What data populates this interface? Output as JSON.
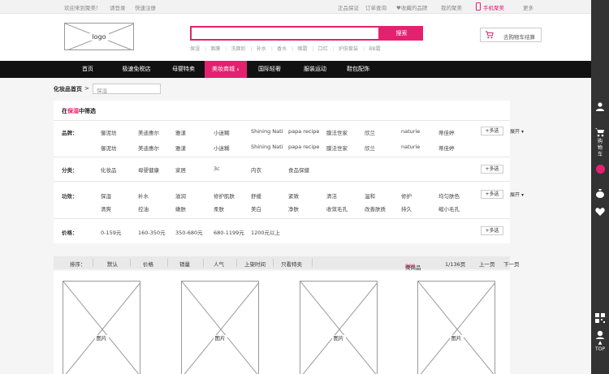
{
  "topbar": {
    "welcome": "欢迎来到聚美！",
    "login": "请登录",
    "register": "快速注册",
    "guarantee": "正品保证",
    "order_query": "订单查询",
    "favorites": "♥收藏的品牌",
    "my_jumei": "我的聚美",
    "mobile": "手机聚美",
    "more": "更多"
  },
  "header": {
    "logo": "logo",
    "search_button": "搜索",
    "hot_words": [
      "保湿",
      "面膜",
      "洗面奶",
      "补水",
      "香水",
      "眼霜",
      "口红",
      "护肤套装",
      "BB霜"
    ],
    "cart_label": "去购物车结算"
  },
  "nav": {
    "items": [
      "首页",
      "极速免税店",
      "母婴特卖",
      "美妆商城",
      "国际轻奢",
      "服装运动",
      "鞋包配饰"
    ],
    "active_arrow": "∨"
  },
  "breadcrumb": {
    "label": "化妆品首页",
    "arrow": ">",
    "input_value": "保湿"
  },
  "filter": {
    "title_prefix": "在",
    "title_keyword": "保湿",
    "title_suffix": "中筛选",
    "multi_label": "+多选",
    "expand_label": "展开",
    "brand": {
      "label": "品牌：",
      "row1": [
        "御泥坊",
        "美迪惠尔",
        "雅漾",
        "小迷糊",
        "Shining Nati",
        "papa recipe",
        "膜法世家",
        "欣兰",
        "naturie",
        "蒂佳婷"
      ],
      "row2": [
        "御泥坊",
        "美迪惠尔",
        "雅漾",
        "小迷糊",
        "Shining Nati",
        "papa recipe",
        "膜法世家",
        "欣兰",
        "naturie",
        "蒂佳婷"
      ]
    },
    "category": {
      "label": "分类：",
      "options": [
        "化妆品",
        "母婴健康",
        "家居",
        "3c",
        "内衣",
        "食品保健"
      ]
    },
    "effect": {
      "label": "功效：",
      "row1": [
        "保湿",
        "补水",
        "滋润",
        "修护肌肤",
        "舒缓",
        "紧致",
        "清洁",
        "温和",
        "修护",
        "均匀肤色"
      ],
      "row2": [
        "清爽",
        "控油",
        "嫩肤",
        "柔肤",
        "美白",
        "净肤",
        "收敛毛孔",
        "改善肤质",
        "持久",
        "缩小毛孔"
      ]
    },
    "price": {
      "label": "价格：",
      "options": [
        "0-159元",
        "160-350元",
        "350-680元",
        "680-1199元",
        "1200元以上"
      ]
    }
  },
  "sortbar": {
    "label": "排序：",
    "options": [
      "默认",
      "价格",
      "销量",
      "人气",
      "上架时间",
      "只看特卖"
    ],
    "count_prefix": "共",
    "count": "980",
    "count_suffix": "个商品",
    "page": "1/136页",
    "prev": "上一页",
    "next": "下一页"
  },
  "products": {
    "labels": [
      "图片",
      "图片",
      "图片",
      "图片"
    ]
  },
  "sidebar": {
    "cart_label": "购物车",
    "top_label": "TOP"
  }
}
